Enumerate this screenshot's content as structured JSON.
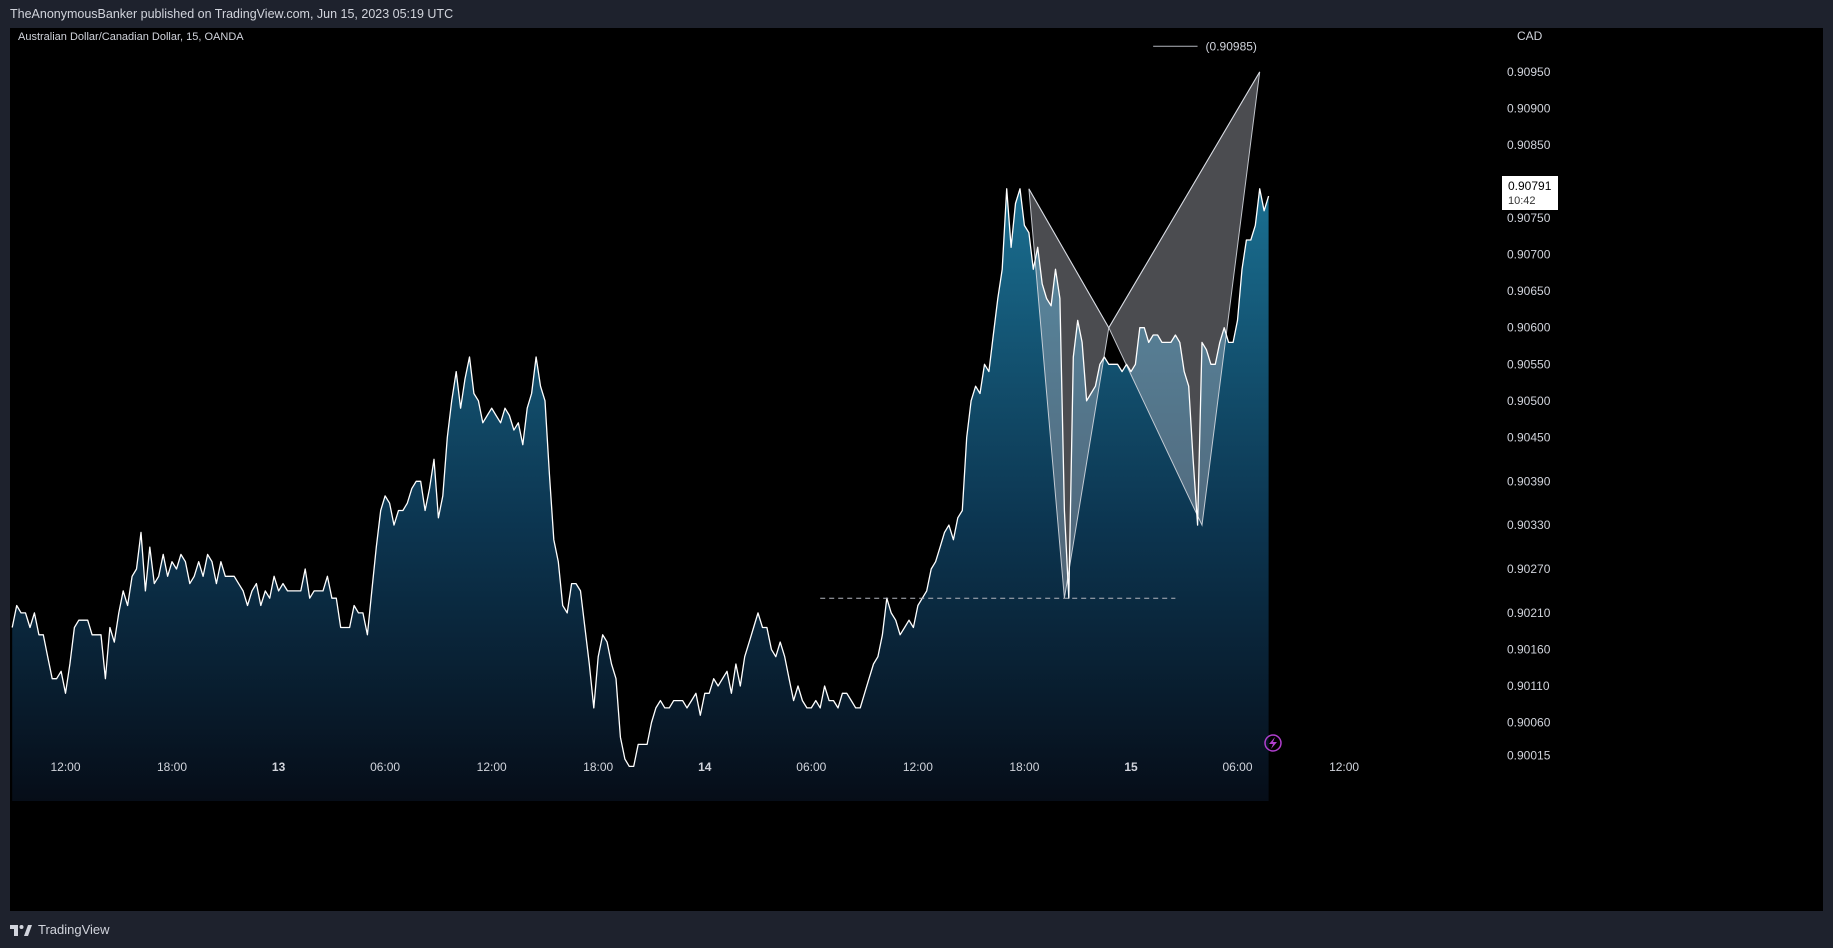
{
  "header": {
    "published": "TheAnonymousBanker published on TradingView.com, Jun 15, 2023 05:19 UTC"
  },
  "footer": {
    "brand": "TradingView"
  },
  "colors": {
    "background": "#000000",
    "frame": "#1e222d",
    "line": "#ffffff",
    "area_top": "#1a6f91",
    "pattern_fill": "#b2b5be",
    "text": "#d1d4dc"
  },
  "chart_data": {
    "type": "area",
    "title": "Australian Dollar/Canadian Dollar, 15, OANDA",
    "symbol": "AUDCAD",
    "interval": "15",
    "exchange": "OANDA",
    "currency_label": "CAD",
    "y_ticks": [
      "0.90950",
      "0.90900",
      "0.90850",
      "0.90750",
      "0.90700",
      "0.90650",
      "0.90600",
      "0.90550",
      "0.90500",
      "0.90450",
      "0.90390",
      "0.90330",
      "0.90270",
      "0.90210",
      "0.90160",
      "0.90110",
      "0.90060",
      "0.90015"
    ],
    "x_ticks": [
      {
        "label": "12:00",
        "t": 0
      },
      {
        "label": "18:00",
        "t": 24
      },
      {
        "label": "13",
        "t": 48,
        "bold": true
      },
      {
        "label": "06:00",
        "t": 72
      },
      {
        "label": "12:00",
        "t": 96
      },
      {
        "label": "18:00",
        "t": 120
      },
      {
        "label": "14",
        "t": 144,
        "bold": true
      },
      {
        "label": "06:00",
        "t": 168
      },
      {
        "label": "12:00",
        "t": 192
      },
      {
        "label": "18:00",
        "t": 216
      },
      {
        "label": "15",
        "t": 240,
        "bold": true
      },
      {
        "label": "06:00",
        "t": 264
      },
      {
        "label": "12:00",
        "t": 288
      }
    ],
    "t_range": [
      -12.5,
      322
    ],
    "y_range": [
      0.8998,
      0.9101
    ],
    "last_price": {
      "value": "0.90791",
      "countdown": "10:42"
    },
    "series": [
      {
        "values": [
          [
            -12,
            0.9019
          ],
          [
            -11,
            0.9022
          ],
          [
            -10,
            0.9021
          ],
          [
            -9,
            0.9021
          ],
          [
            -8,
            0.9019
          ],
          [
            -7,
            0.9021
          ],
          [
            -6,
            0.9018
          ],
          [
            -5,
            0.9018
          ],
          [
            -4,
            0.9015
          ],
          [
            -3,
            0.9012
          ],
          [
            -2,
            0.9012
          ],
          [
            -1,
            0.9013
          ],
          [
            0,
            0.901
          ],
          [
            1,
            0.9014
          ],
          [
            2,
            0.9019
          ],
          [
            3,
            0.902
          ],
          [
            4,
            0.902
          ],
          [
            5,
            0.902
          ],
          [
            6,
            0.9018
          ],
          [
            7,
            0.9018
          ],
          [
            8,
            0.9018
          ],
          [
            9,
            0.9012
          ],
          [
            10,
            0.9019
          ],
          [
            11,
            0.9017
          ],
          [
            12,
            0.9021
          ],
          [
            13,
            0.9024
          ],
          [
            14,
            0.9022
          ],
          [
            15,
            0.9026
          ],
          [
            16,
            0.9027
          ],
          [
            17,
            0.9032
          ],
          [
            18,
            0.9024
          ],
          [
            19,
            0.903
          ],
          [
            20,
            0.9025
          ],
          [
            21,
            0.9026
          ],
          [
            22,
            0.9029
          ],
          [
            23,
            0.9026
          ],
          [
            24,
            0.9028
          ],
          [
            25,
            0.9027
          ],
          [
            26,
            0.9029
          ],
          [
            27,
            0.9028
          ],
          [
            28,
            0.9025
          ],
          [
            29,
            0.9026
          ],
          [
            30,
            0.9028
          ],
          [
            31,
            0.9026
          ],
          [
            32,
            0.9029
          ],
          [
            33,
            0.9028
          ],
          [
            34,
            0.9025
          ],
          [
            35,
            0.9028
          ],
          [
            36,
            0.9026
          ],
          [
            37,
            0.9026
          ],
          [
            38,
            0.9026
          ],
          [
            39,
            0.9025
          ],
          [
            40,
            0.9024
          ],
          [
            41,
            0.9022
          ],
          [
            42,
            0.9024
          ],
          [
            43,
            0.9025
          ],
          [
            44,
            0.9022
          ],
          [
            45,
            0.9024
          ],
          [
            46,
            0.9023
          ],
          [
            47,
            0.9026
          ],
          [
            48,
            0.9024
          ],
          [
            49,
            0.9025
          ],
          [
            50,
            0.9024
          ],
          [
            51,
            0.9024
          ],
          [
            52,
            0.9024
          ],
          [
            53,
            0.9024
          ],
          [
            54,
            0.9027
          ],
          [
            55,
            0.9023
          ],
          [
            56,
            0.9024
          ],
          [
            57,
            0.9024
          ],
          [
            58,
            0.9024
          ],
          [
            59,
            0.9026
          ],
          [
            60,
            0.9023
          ],
          [
            61,
            0.9023
          ],
          [
            62,
            0.9019
          ],
          [
            63,
            0.9019
          ],
          [
            64,
            0.9019
          ],
          [
            65,
            0.9022
          ],
          [
            66,
            0.9021
          ],
          [
            67,
            0.9021
          ],
          [
            68,
            0.9018
          ],
          [
            69,
            0.9024
          ],
          [
            70,
            0.903
          ],
          [
            71,
            0.9035
          ],
          [
            72,
            0.9037
          ],
          [
            73,
            0.9036
          ],
          [
            74,
            0.9033
          ],
          [
            75,
            0.9035
          ],
          [
            76,
            0.9035
          ],
          [
            77,
            0.9036
          ],
          [
            78,
            0.9038
          ],
          [
            79,
            0.9039
          ],
          [
            80,
            0.9039
          ],
          [
            81,
            0.9035
          ],
          [
            82,
            0.9038
          ],
          [
            83,
            0.9042
          ],
          [
            84,
            0.9034
          ],
          [
            85,
            0.9037
          ],
          [
            86,
            0.9045
          ],
          [
            87,
            0.905
          ],
          [
            88,
            0.9054
          ],
          [
            89,
            0.9049
          ],
          [
            90,
            0.9053
          ],
          [
            91,
            0.9056
          ],
          [
            92,
            0.9051
          ],
          [
            93,
            0.905
          ],
          [
            94,
            0.9047
          ],
          [
            95,
            0.9048
          ],
          [
            96,
            0.9049
          ],
          [
            97,
            0.9048
          ],
          [
            98,
            0.9047
          ],
          [
            99,
            0.9049
          ],
          [
            100,
            0.9048
          ],
          [
            101,
            0.9046
          ],
          [
            102,
            0.9047
          ],
          [
            103,
            0.9044
          ],
          [
            104,
            0.9049
          ],
          [
            105,
            0.9051
          ],
          [
            106,
            0.9056
          ],
          [
            107,
            0.9052
          ],
          [
            108,
            0.905
          ],
          [
            109,
            0.904
          ],
          [
            110,
            0.9031
          ],
          [
            111,
            0.9028
          ],
          [
            112,
            0.9022
          ],
          [
            113,
            0.9021
          ],
          [
            114,
            0.9025
          ],
          [
            115,
            0.9025
          ],
          [
            116,
            0.9024
          ],
          [
            117,
            0.9019
          ],
          [
            118,
            0.9014
          ],
          [
            119,
            0.9008
          ],
          [
            120,
            0.9015
          ],
          [
            121,
            0.9018
          ],
          [
            122,
            0.9017
          ],
          [
            123,
            0.9014
          ],
          [
            124,
            0.9012
          ],
          [
            125,
            0.9004
          ],
          [
            126,
            0.9001
          ],
          [
            127,
            0.9
          ],
          [
            128,
            0.9
          ],
          [
            129,
            0.9003
          ],
          [
            130,
            0.9003
          ],
          [
            131,
            0.9003
          ],
          [
            132,
            0.9006
          ],
          [
            133,
            0.9008
          ],
          [
            134,
            0.9009
          ],
          [
            135,
            0.9008
          ],
          [
            136,
            0.9008
          ],
          [
            137,
            0.9009
          ],
          [
            138,
            0.9009
          ],
          [
            139,
            0.9009
          ],
          [
            140,
            0.9008
          ],
          [
            141,
            0.9009
          ],
          [
            142,
            0.901
          ],
          [
            143,
            0.9007
          ],
          [
            144,
            0.901
          ],
          [
            145,
            0.901
          ],
          [
            146,
            0.9012
          ],
          [
            147,
            0.9011
          ],
          [
            148,
            0.9012
          ],
          [
            149,
            0.9013
          ],
          [
            150,
            0.901
          ],
          [
            151,
            0.9014
          ],
          [
            152,
            0.9011
          ],
          [
            153,
            0.9015
          ],
          [
            154,
            0.9017
          ],
          [
            155,
            0.9019
          ],
          [
            156,
            0.9021
          ],
          [
            157,
            0.9019
          ],
          [
            158,
            0.9019
          ],
          [
            159,
            0.9016
          ],
          [
            160,
            0.9015
          ],
          [
            161,
            0.9017
          ],
          [
            162,
            0.9015
          ],
          [
            163,
            0.9012
          ],
          [
            164,
            0.9009
          ],
          [
            165,
            0.9011
          ],
          [
            166,
            0.9009
          ],
          [
            167,
            0.9008
          ],
          [
            168,
            0.9008
          ],
          [
            169,
            0.9009
          ],
          [
            170,
            0.9008
          ],
          [
            171,
            0.9011
          ],
          [
            172,
            0.9009
          ],
          [
            173,
            0.9009
          ],
          [
            174,
            0.9008
          ],
          [
            175,
            0.901
          ],
          [
            176,
            0.901
          ],
          [
            177,
            0.9009
          ],
          [
            178,
            0.9008
          ],
          [
            179,
            0.9008
          ],
          [
            180,
            0.901
          ],
          [
            181,
            0.9012
          ],
          [
            182,
            0.9014
          ],
          [
            183,
            0.9015
          ],
          [
            184,
            0.9018
          ],
          [
            185,
            0.9023
          ],
          [
            186,
            0.9021
          ],
          [
            187,
            0.902
          ],
          [
            188,
            0.9018
          ],
          [
            189,
            0.9019
          ],
          [
            190,
            0.902
          ],
          [
            191,
            0.9019
          ],
          [
            192,
            0.9022
          ],
          [
            193,
            0.9023
          ],
          [
            194,
            0.9024
          ],
          [
            195,
            0.9027
          ],
          [
            196,
            0.9028
          ],
          [
            197,
            0.903
          ],
          [
            198,
            0.9032
          ],
          [
            199,
            0.9033
          ],
          [
            200,
            0.9031
          ],
          [
            201,
            0.9034
          ],
          [
            202,
            0.9035
          ],
          [
            203,
            0.9045
          ],
          [
            204,
            0.905
          ],
          [
            205,
            0.9052
          ],
          [
            206,
            0.9051
          ],
          [
            207,
            0.9055
          ],
          [
            208,
            0.9054
          ],
          [
            209,
            0.9059
          ],
          [
            210,
            0.9064
          ],
          [
            211,
            0.9068
          ],
          [
            212,
            0.9079
          ],
          [
            213,
            0.9071
          ],
          [
            214,
            0.9077
          ],
          [
            215,
            0.9079
          ],
          [
            216,
            0.9074
          ],
          [
            217,
            0.9073
          ],
          [
            218,
            0.9068
          ],
          [
            219,
            0.9071
          ],
          [
            220,
            0.9066
          ],
          [
            221,
            0.9064
          ],
          [
            222,
            0.9063
          ],
          [
            223,
            0.9068
          ],
          [
            224,
            0.9064
          ],
          [
            225,
            0.9035
          ],
          [
            226,
            0.9023
          ],
          [
            227,
            0.9056
          ],
          [
            228,
            0.9061
          ],
          [
            229,
            0.9058
          ],
          [
            230,
            0.905
          ],
          [
            231,
            0.9051
          ],
          [
            232,
            0.9052
          ],
          [
            233,
            0.9055
          ],
          [
            234,
            0.9056
          ],
          [
            235,
            0.9055
          ],
          [
            236,
            0.9055
          ],
          [
            237,
            0.9055
          ],
          [
            238,
            0.9054
          ],
          [
            239,
            0.9055
          ],
          [
            240,
            0.9054
          ],
          [
            241,
            0.9055
          ],
          [
            242,
            0.906
          ],
          [
            243,
            0.906
          ],
          [
            244,
            0.9058
          ],
          [
            245,
            0.9059
          ],
          [
            246,
            0.9059
          ],
          [
            247,
            0.9058
          ],
          [
            248,
            0.9058
          ],
          [
            249,
            0.9058
          ],
          [
            250,
            0.9059
          ],
          [
            251,
            0.9058
          ],
          [
            252,
            0.9054
          ],
          [
            253,
            0.9052
          ],
          [
            254,
            0.9042
          ],
          [
            255,
            0.9033
          ],
          [
            256,
            0.9058
          ],
          [
            257,
            0.9057
          ],
          [
            258,
            0.9055
          ],
          [
            259,
            0.9055
          ],
          [
            260,
            0.9058
          ],
          [
            261,
            0.906
          ],
          [
            262,
            0.9058
          ],
          [
            263,
            0.9058
          ],
          [
            264,
            0.9061
          ],
          [
            265,
            0.9068
          ],
          [
            266,
            0.9072
          ],
          [
            267,
            0.9072
          ],
          [
            268,
            0.9074
          ],
          [
            269,
            0.9079
          ],
          [
            270,
            0.9076
          ],
          [
            271,
            0.9078
          ]
        ]
      }
    ],
    "pattern": {
      "points": [
        [
          217,
          0.9079
        ],
        [
          225,
          0.9023
        ],
        [
          235,
          0.906
        ],
        [
          256,
          0.9033
        ],
        [
          269,
          0.9095
        ]
      ],
      "target_label": "(0.90985)",
      "target_t": [
        245,
        255
      ],
      "target_y": 0.90985
    },
    "support_level": {
      "y": 0.9023,
      "t_start": 170,
      "t_end": 250
    },
    "grid": false
  }
}
